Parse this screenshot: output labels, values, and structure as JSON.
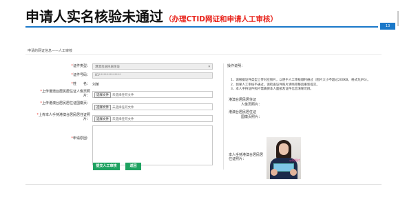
{
  "slide": {
    "title": "申请人实名核验未通过",
    "subtitle": "（办理CTID网证和申请人工审核）",
    "page_number": "13",
    "accent_color": "#1a78c9",
    "subtitle_color": "#e8231b"
  },
  "breadcrumb": "申请的网证信息——人工审核",
  "form": {
    "fields": [
      {
        "label": "证件类型：",
        "required": true,
        "type": "select",
        "value": "港澳台居民居住证"
      },
      {
        "label": "证件号码：",
        "required": true,
        "type": "input",
        "value": "81**************"
      },
      {
        "label": "姓　　名：",
        "required": true,
        "type": "text",
        "value": "刘某"
      },
      {
        "label": "上传港澳台居民居住证人像页照片：",
        "required": true,
        "type": "file",
        "button": "选择文件",
        "value": "未选择任何文件"
      },
      {
        "label": "上传港澳台居民居住证国徽页：",
        "required": true,
        "type": "file",
        "button": "选择文件",
        "value": "未选择任何文件"
      },
      {
        "label": "上传本人手持港澳台居民居住证照片：",
        "required": true,
        "type": "file",
        "button": "选择文件",
        "value": "未选择任何文件"
      },
      {
        "label": "申请原因：",
        "required": true,
        "type": "textarea",
        "value": ""
      }
    ],
    "buttons": {
      "submit": "提交人工审核",
      "back": "返回"
    },
    "button_color": "#1fa261"
  },
  "instructions": {
    "title": "操作说明：",
    "items": [
      "1、请根据证件类型上传对应照片，以便于人工审核顺利通过（图片大小不超过200KB，格式为JPG）。",
      "2、如果人工审核不通过，请检查证件照片清晰完整后重新提交。",
      "3、本人手持证件照片需确保本人面部及证件信息清晰可辨。"
    ],
    "samples": [
      {
        "heading": "港澳台居民居住证",
        "label": "人像页照片："
      },
      {
        "heading": "港澳台居民居住证",
        "label": "国徽页照片："
      }
    ],
    "handheld_label": "本人手持港澳台居民居住证照片：",
    "photo_mark": "示例照片"
  }
}
